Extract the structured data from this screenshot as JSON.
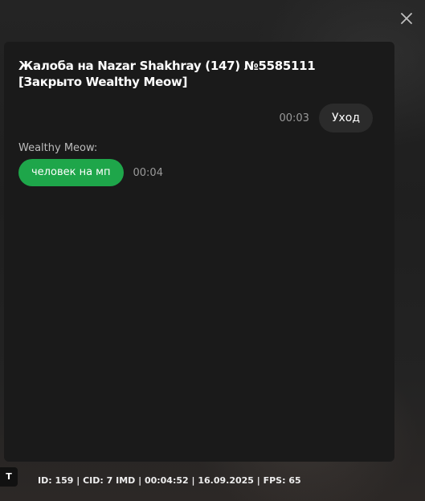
{
  "dialog": {
    "title": "Жалоба на Nazar Shakhray (147) №5585111 [Закрыто Wealthy Meow]",
    "close_icon": "close-icon"
  },
  "messages": {
    "outgoing": {
      "time": "00:03",
      "text": "Уход"
    },
    "incoming": {
      "sender": "Wealthy Meow:",
      "text": "человек на мп",
      "time": "00:04",
      "bubble_color": "#1ea64a"
    }
  },
  "hud": {
    "key_label": "T",
    "status": "ID: 159 | CID: 7 IMD | 00:04:52 | 16.09.2025 | FPS: 65"
  }
}
